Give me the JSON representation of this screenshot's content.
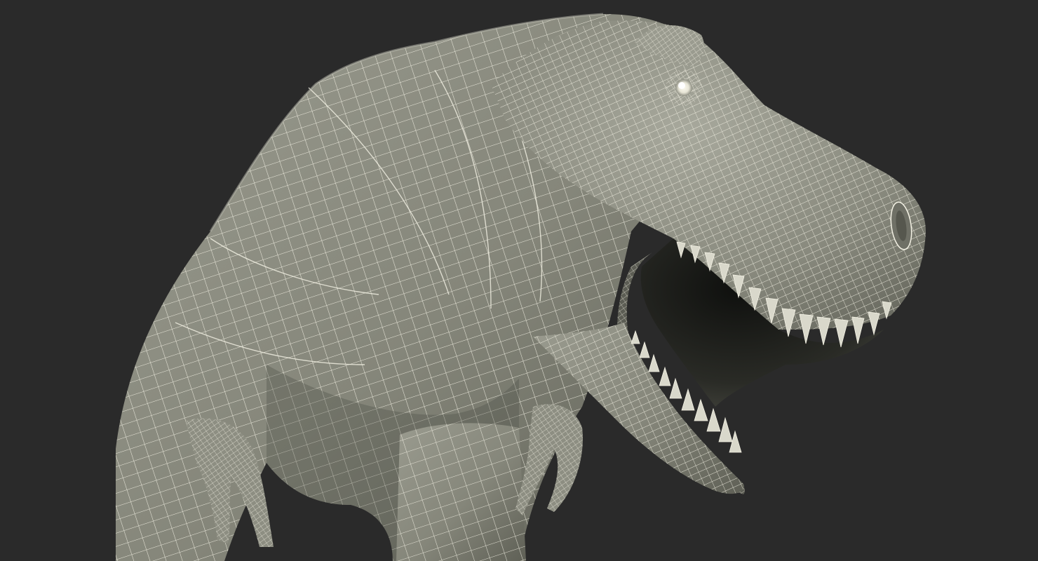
{
  "viewport": {
    "background_color": "#2a2a2a"
  },
  "model": {
    "subject": "tyrannosaurus-rex-upper-body",
    "render_style": "wireframe-over-shaded",
    "surface_color": "#85867a",
    "surface_highlight_color": "#a9aa9e",
    "surface_shadow_color": "#55564d",
    "wire_color": "#f3f1e4",
    "mouth_interior_color": "#1b1c19",
    "tooth_color": "#d9d8cb"
  }
}
